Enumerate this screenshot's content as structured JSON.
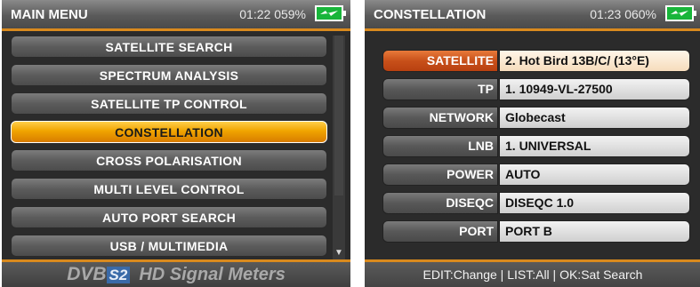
{
  "left_screen": {
    "title": "MAIN MENU",
    "time": "01:22",
    "battery_percent": "059%",
    "menu_items": [
      {
        "label": "SATELLITE SEARCH"
      },
      {
        "label": "SPECTRUM ANALYSIS"
      },
      {
        "label": "SATELLITE TP CONTROL"
      },
      {
        "label": "CONSTELLATION",
        "selected": true
      },
      {
        "label": "CROSS POLARISATION"
      },
      {
        "label": "MULTI LEVEL CONTROL"
      },
      {
        "label": "AUTO PORT SEARCH"
      },
      {
        "label": "USB / MULTIMEDIA"
      }
    ],
    "footer": {
      "dvb": "DVB",
      "s2": "S2",
      "rest": "HD Signal Meters"
    }
  },
  "right_screen": {
    "title": "CONSTELLATION",
    "time": "01:23",
    "battery_percent": "060%",
    "rows": [
      {
        "label": "SATELLITE",
        "value": "2. Hot Bird 13B/C/ (13°E)",
        "selected": true
      },
      {
        "label": "TP",
        "value": "1. 10949-VL-27500"
      },
      {
        "label": "NETWORK",
        "value": "Globecast"
      },
      {
        "label": "LNB",
        "value": "1. UNIVERSAL"
      },
      {
        "label": "POWER",
        "value": "AUTO"
      },
      {
        "label": "DISEQC",
        "value": "DISEQC 1.0"
      },
      {
        "label": "PORT",
        "value": "PORT B"
      }
    ],
    "footer": "EDIT:Change | LIST:All | OK:Sat Search"
  },
  "colors": {
    "accent": "#d98a1e",
    "selected_menu": "#f0a400",
    "selected_row_label": "#c8501a",
    "battery": "#18b53a"
  },
  "icons": {
    "battery": "battery-charging-icon",
    "scroll_down": "arrow-down-icon"
  }
}
